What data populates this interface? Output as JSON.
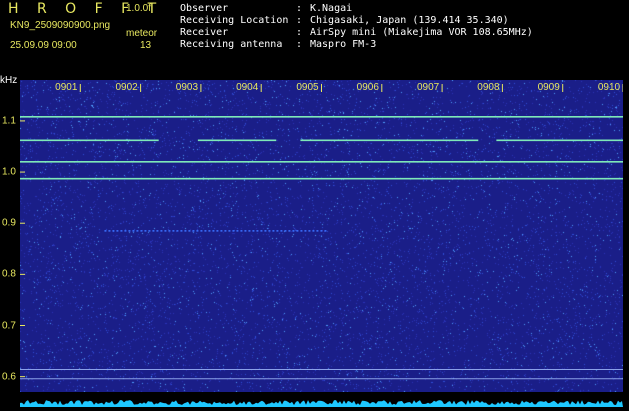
{
  "header": {
    "app_title": "H R O F F T",
    "version": "1.0.0f",
    "filename": "KN9_2509090900.png",
    "meteor_label": "meteor",
    "datetime": "25.09.09 09:00",
    "meteor_count": "13"
  },
  "info": [
    {
      "label": "Observer",
      "value": "K.Nagai"
    },
    {
      "label": "Receiving Location",
      "value": "Chigasaki, Japan (139.414 35.340)"
    },
    {
      "label": "Receiver",
      "value": "AirSpy mini (Miakejima VOR 108.65MHz)"
    },
    {
      "label": "Receiving antenna",
      "value": "Maspro FM-3"
    }
  ],
  "colors": {
    "background": "#000000",
    "plot_background": "#1a1e88",
    "label_color": "#e8e860",
    "text_color": "#ffffff",
    "signal_color": "#7ee8b8",
    "noise_color": "#1ec8ff"
  },
  "chart_data": {
    "type": "heatmap",
    "unit_label": "kHz",
    "ylim": [
      0.57,
      1.18
    ],
    "yticks": [
      "1.1",
      "1.0",
      "0.9",
      "0.8",
      "0.7",
      "0.6"
    ],
    "ytick_values": [
      1.1,
      1.0,
      0.9,
      0.8,
      0.7,
      0.6
    ],
    "xlim": [
      0,
      10
    ],
    "xticks": [
      "0901",
      "0902",
      "0903",
      "0904",
      "0905",
      "0906",
      "0907",
      "0908",
      "0909",
      "0910"
    ],
    "xtick_values": [
      1,
      2,
      3,
      4,
      5,
      6,
      7,
      8,
      9,
      10
    ],
    "carrier_lines": [
      {
        "freq": 1.108,
        "segments": [
          [
            0,
            10
          ]
        ]
      },
      {
        "freq": 1.062,
        "segments": [
          [
            0,
            2.3
          ],
          [
            2.95,
            4.25
          ],
          [
            4.65,
            7.6
          ],
          [
            7.9,
            10
          ]
        ]
      },
      {
        "freq": 1.02,
        "segments": [
          [
            0,
            10
          ]
        ]
      },
      {
        "freq": 0.987,
        "segments": [
          [
            0,
            10
          ]
        ]
      },
      {
        "freq": 0.885,
        "segments": [
          [
            1.4,
            5.1
          ]
        ]
      },
      {
        "freq": 0.614,
        "segments": [
          [
            0,
            10
          ]
        ]
      },
      {
        "freq": 0.596,
        "segments": [
          [
            0,
            10
          ]
        ]
      }
    ]
  }
}
